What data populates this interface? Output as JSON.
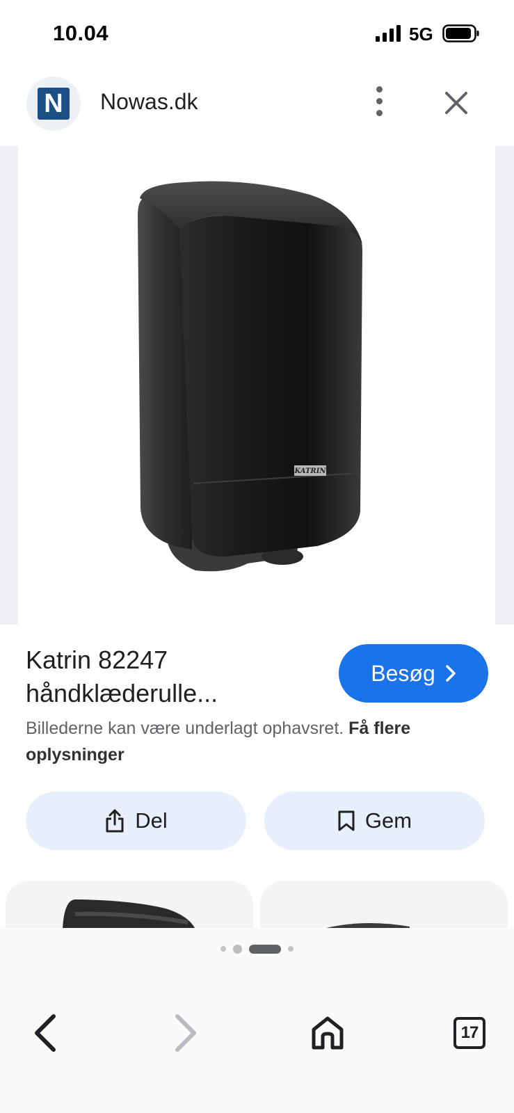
{
  "status_bar": {
    "time": "10.04",
    "network": "5G"
  },
  "header": {
    "logo_letter": "N",
    "site_name": "Nowas.dk"
  },
  "product_image": {
    "brand_plate": "KATRIN"
  },
  "info": {
    "title_line1": "Katrin 82247",
    "title_line2": "håndklæderulle...",
    "visit_label": "Besøg",
    "copyright_text": "Billederne kan være underlagt ophavsret.",
    "more_info_link": "Få flere oplysninger"
  },
  "actions": {
    "share_label": "Del",
    "save_label": "Gem"
  },
  "bottom_nav": {
    "tab_count": "17"
  },
  "colors": {
    "accent": "#1a73e8",
    "action_bg": "#e7effc",
    "logo_tile": "#1a4f87"
  },
  "icons": [
    "signal-icon",
    "battery-icon",
    "more-vert-icon",
    "close-icon",
    "chevron-right-icon",
    "share-icon",
    "bookmark-icon",
    "back-arrow-icon",
    "forward-arrow-icon",
    "home-icon",
    "tabs-icon"
  ]
}
